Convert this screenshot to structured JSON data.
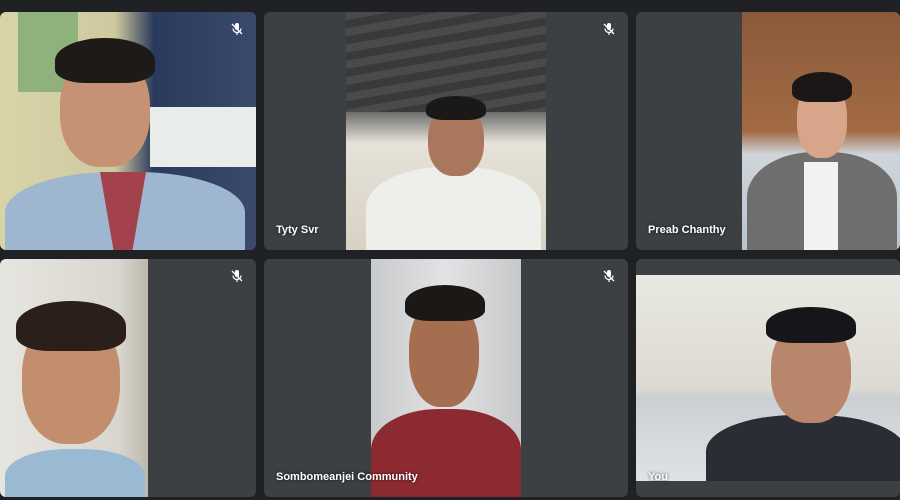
{
  "participants": [
    {
      "name": "",
      "muted": true
    },
    {
      "name": "Tyty Svr",
      "muted": true
    },
    {
      "name": "Preab Chanthy",
      "muted": false
    },
    {
      "name": "",
      "muted": true
    },
    {
      "name": "Sombomeanjei Community",
      "muted": true
    },
    {
      "name": "You",
      "muted": false
    }
  ],
  "colors": {
    "background": "#202124",
    "tile": "#3c4043",
    "name_text": "#ffffff"
  },
  "icons": {
    "muted": "mic-off-icon"
  }
}
